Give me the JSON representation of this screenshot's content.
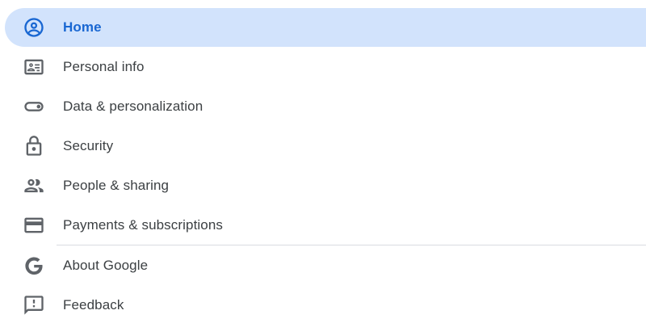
{
  "colors": {
    "active_background": "#d2e3fc",
    "active_text": "#1967d2",
    "text": "#3c4043",
    "icon": "#5f6368",
    "divider": "#dadce0"
  },
  "nav": {
    "items": [
      {
        "label": "Home",
        "icon": "account-circle-icon",
        "active": true
      },
      {
        "label": "Personal info",
        "icon": "id-card-icon",
        "active": false
      },
      {
        "label": "Data & personalization",
        "icon": "toggle-icon",
        "active": false
      },
      {
        "label": "Security",
        "icon": "lock-icon",
        "active": false
      },
      {
        "label": "People & sharing",
        "icon": "people-icon",
        "active": false
      },
      {
        "label": "Payments & subscriptions",
        "icon": "credit-card-icon",
        "active": false
      }
    ],
    "secondary_items": [
      {
        "label": "About Google",
        "icon": "google-g-icon",
        "active": false
      },
      {
        "label": "Feedback",
        "icon": "feedback-icon",
        "active": false
      }
    ]
  }
}
